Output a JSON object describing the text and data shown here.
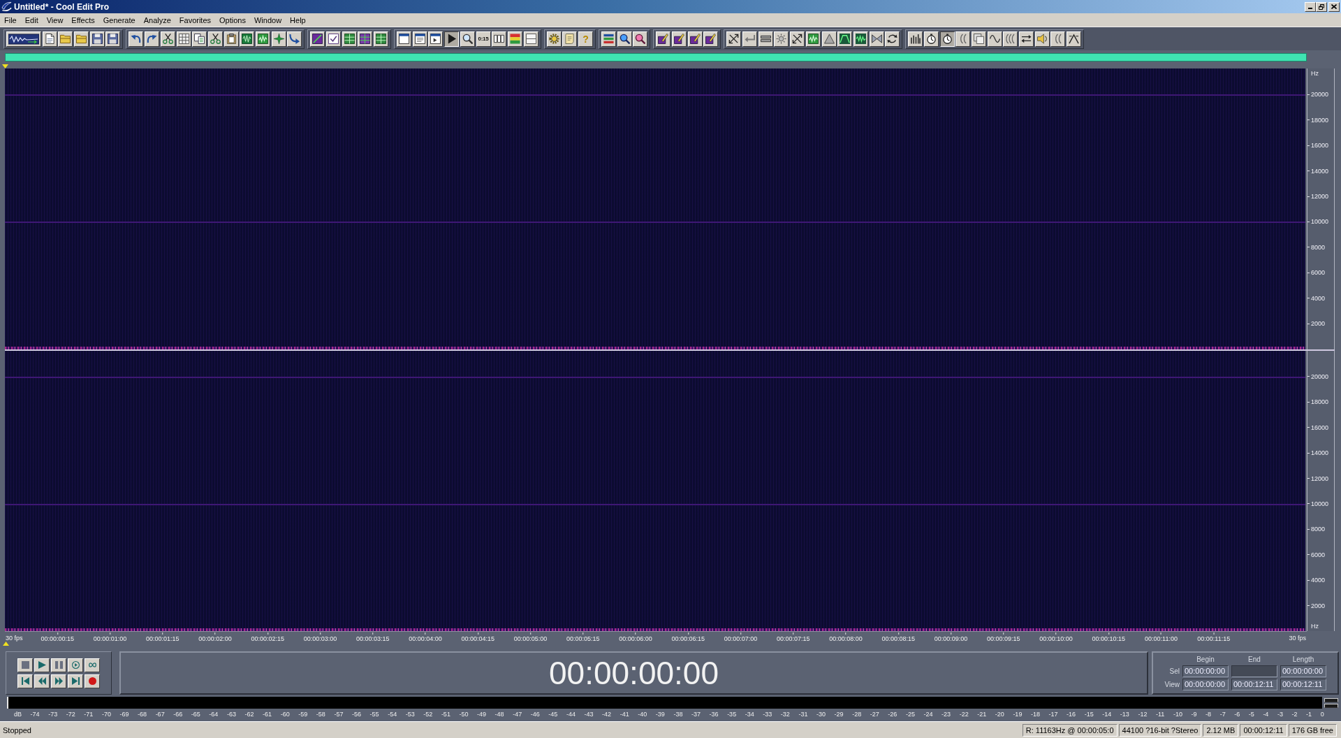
{
  "window": {
    "title": "Untitled* - Cool Edit Pro"
  },
  "menu": [
    "File",
    "Edit",
    "View",
    "Effects",
    "Generate",
    "Analyze",
    "Favorites",
    "Options",
    "Window",
    "Help"
  ],
  "toolbar": [
    {
      "buttons": [
        {
          "pressed": false
        },
        {
          "pressed": false
        },
        {
          "pressed": false
        },
        {
          "pressed": false
        },
        {
          "pressed": false
        },
        {
          "pressed": false
        }
      ]
    },
    {
      "buttons": [
        {
          "pressed": false
        },
        {
          "pressed": false
        },
        {
          "pressed": false
        },
        {
          "pressed": false
        },
        {
          "pressed": false
        },
        {
          "pressed": false
        },
        {
          "pressed": false
        },
        {
          "pressed": false
        },
        {
          "pressed": false
        },
        {
          "pressed": false
        },
        {
          "pressed": false
        }
      ]
    },
    {
      "buttons": [
        {
          "pressed": false
        },
        {
          "pressed": false
        },
        {
          "pressed": false
        },
        {
          "pressed": false
        },
        {
          "pressed": false
        }
      ]
    },
    {
      "buttons": [
        {
          "pressed": false
        },
        {
          "pressed": false
        },
        {
          "pressed": false
        },
        {
          "pressed": true
        },
        {
          "pressed": false
        },
        {
          "label": "0:15",
          "pressed": false
        },
        {
          "pressed": false
        },
        {
          "pressed": false
        },
        {
          "pressed": false
        }
      ]
    },
    {
      "buttons": [
        {
          "pressed": false
        },
        {
          "pressed": false
        },
        {
          "label": "?",
          "pressed": false
        }
      ]
    },
    {
      "buttons": [
        {
          "pressed": false
        },
        {
          "pressed": false
        },
        {
          "pressed": false
        }
      ]
    },
    {
      "buttons": [
        {
          "pressed": false
        },
        {
          "pressed": false
        },
        {
          "pressed": false
        },
        {
          "pressed": false
        }
      ]
    },
    {
      "buttons": [
        {
          "pressed": false
        },
        {
          "pressed": false
        },
        {
          "pressed": false
        },
        {
          "pressed": false
        },
        {
          "pressed": false
        },
        {
          "pressed": false
        },
        {
          "pressed": false
        },
        {
          "pressed": false
        },
        {
          "pressed": false
        },
        {
          "pressed": false
        },
        {
          "pressed": false
        }
      ]
    },
    {
      "buttons": [
        {
          "pressed": false
        },
        {
          "pressed": false
        },
        {
          "pressed": true
        },
        {
          "pressed": false
        },
        {
          "pressed": false
        },
        {
          "pressed": false
        },
        {
          "pressed": false
        },
        {
          "pressed": false
        },
        {
          "pressed": false
        },
        {
          "pressed": false
        },
        {
          "pressed": false
        }
      ]
    }
  ],
  "channels": [
    {
      "unit_top": "Hz",
      "ticks": [
        "20000",
        "18000",
        "16000",
        "14000",
        "12000",
        "10000",
        "8000",
        "6000",
        "4000",
        "2000"
      ]
    },
    {
      "ticks": [
        "20000",
        "18000",
        "16000",
        "14000",
        "12000",
        "10000",
        "8000",
        "6000",
        "4000",
        "2000"
      ],
      "unit_bottom": "Hz"
    }
  ],
  "ruler": {
    "frame_rate_left": "30 fps",
    "ticks": [
      "00:00:00:15",
      "00:00:01:00",
      "00:00:01:15",
      "00:00:02:00",
      "00:00:02:15",
      "00:00:03:00",
      "00:00:03:15",
      "00:00:04:00",
      "00:00:04:15",
      "00:00:05:00",
      "00:00:05:15",
      "00:00:06:00",
      "00:00:06:15",
      "00:00:07:00",
      "00:00:07:15",
      "00:00:08:00",
      "00:00:08:15",
      "00:00:09:00",
      "00:00:09:15",
      "00:00:10:00",
      "00:00:10:15",
      "00:00:11:00",
      "00:00:11:15"
    ],
    "frame_rate_right": "30 fps"
  },
  "time_display": "00:00:00:00",
  "selection_panel": {
    "headers": [
      "Begin",
      "End",
      "Length"
    ],
    "rows": [
      {
        "label": "Sel",
        "begin": "00:00:00:00",
        "length": "00:00:00:00"
      },
      {
        "label": "View",
        "begin": "00:00:00:00",
        "end": "00:00:12:11",
        "length": "00:00:12:11"
      }
    ]
  },
  "level_meter": {
    "unit": "dB",
    "ticks": [
      "-74",
      "-73",
      "-72",
      "-71",
      "-70",
      "-69",
      "-68",
      "-67",
      "-66",
      "-65",
      "-64",
      "-63",
      "-62",
      "-61",
      "-60",
      "-59",
      "-58",
      "-57",
      "-56",
      "-55",
      "-54",
      "-53",
      "-52",
      "-51",
      "-50",
      "-49",
      "-48",
      "-47",
      "-46",
      "-45",
      "-44",
      "-43",
      "-42",
      "-41",
      "-40",
      "-39",
      "-38",
      "-37",
      "-36",
      "-35",
      "-34",
      "-33",
      "-32",
      "-31",
      "-30",
      "-29",
      "-28",
      "-27",
      "-26",
      "-25",
      "-24",
      "-23",
      "-22",
      "-21",
      "-20",
      "-19",
      "-18",
      "-17",
      "-16",
      "-15",
      "-14",
      "-13",
      "-12",
      "-11",
      "-10",
      "-9",
      "-8",
      "-7",
      "-6",
      "-5",
      "-4",
      "-3",
      "-2",
      "-1",
      "0"
    ]
  },
  "status_bar": {
    "state": "Stopped",
    "fields": [
      "R: 11163Hz @ 00:00:05:0",
      "44100 ?16-bit ?Stereo",
      "2.12 MB",
      "00:00:12:11",
      "176 GB free"
    ]
  }
}
